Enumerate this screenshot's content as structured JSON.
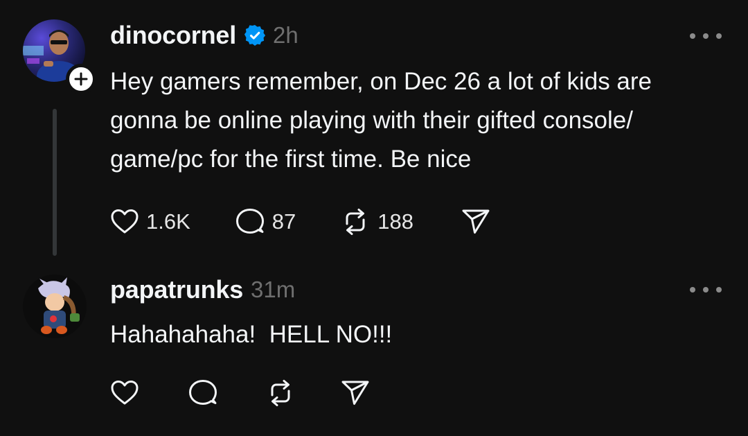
{
  "posts": [
    {
      "username": "dinocornel",
      "verified": true,
      "time": "2h",
      "text": "Hey gamers remember, on Dec 26 a lot of kids are\ngonna be online playing with their gifted console/\ngame/pc for the first time. Be nice",
      "likes": "1.6K",
      "replies": "87",
      "reposts": "188"
    },
    {
      "username": "papatrunks",
      "verified": false,
      "time": "31m",
      "text": "Hahahahaha!  HELL NO!!!"
    }
  ],
  "icons": [
    "verified-badge-icon",
    "plus-icon",
    "more-icon",
    "heart-icon",
    "comment-icon",
    "repost-icon",
    "share-icon"
  ],
  "colors": {
    "background": "#101010",
    "text": "#f3f5f7",
    "muted": "#6f6f6f",
    "verified": "#0095f6",
    "thread_line": "#333638"
  }
}
